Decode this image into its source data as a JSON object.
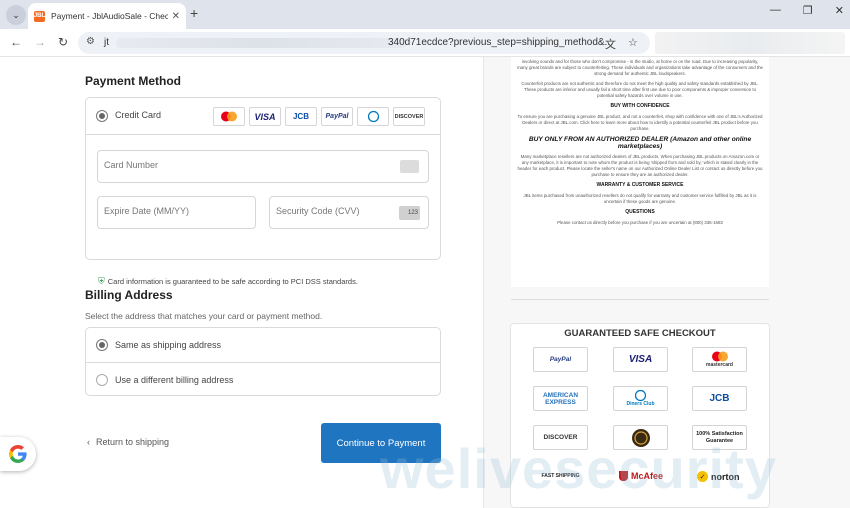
{
  "browser": {
    "tab_title": "Payment - JblAudioSale - Check",
    "tab_favicon": "JBL",
    "url_host": "jt",
    "url_path": "340d71ecdce?previous_step=shipping_method&..."
  },
  "payment": {
    "heading": "Payment Method",
    "credit_card_label": "Credit Card",
    "brands": [
      "mastercard",
      "VISA",
      "JCB",
      "PayPal",
      "Diners Club",
      "DISCOVER"
    ],
    "card_number_placeholder": "Card Number",
    "expiry_placeholder": "Expire Date (MM/YY)",
    "cvv_placeholder": "Security Code (CVV)",
    "cvv_icon_text": "123",
    "pci_note": "Card information is guaranteed to be safe according to PCI DSS standards."
  },
  "billing": {
    "heading": "Billing Address",
    "subtitle": "Select the address that matches your card or payment method.",
    "options": [
      "Same as shipping address",
      "Use a different billing address"
    ]
  },
  "actions": {
    "return_label": "Return to shipping",
    "continue_label": "Continue to Payment"
  },
  "doc": {
    "p1": "involving sounds and for those who don't compromise - in the studio, at home or on the road. Due to increasing popularity, many great brands are subject to counterfeiting. These individuals and organizations take advantage of the consumers and the strong demand for authentic JBL loudspeakers.",
    "p2": "Counterfeit products are not authentic and therefore do not meet the high quality and safety standards established by JBL. These products are inferior and usually fail a short time after first use due to poor components & improper conversion to potential safety hazards over volume in use.",
    "h1": "BUY WITH CONFIDENCE",
    "p3": "To ensure you are purchasing a genuine JBL product, and not a counterfeit, shop with confidence with one of JBL's Authorized Dealers or direct at JBL.com. Click here to learn more about how to identify a potential counterfeit JBL product before you purchase.",
    "h2": "BUY ONLY FROM AN AUTHORIZED DEALER (Amazon and other online marketplaces)",
    "p4": "Many marketplace resellers are not authorized dealers of JBL products. When purchasing JBL products on Amazon.com or any marketplace, it is important to note whom the product is being 'shipped from and sold by,' which is stated clearly in the header for each product. Please locate the seller's name on our Authorized Online Dealer List or contact us directly before you purchase to ensure they are an authorized dealer.",
    "h3": "WARRANTY & CUSTOMER SERVICE",
    "p5": "JBL items purchased from unauthorized resellers do not qualify for warranty and customer service fulfilled by JBL as it is uncertain if these goods are genuine.",
    "h4": "QUESTIONS",
    "p6": "Please contact us directly before you purchase if you are uncertain at (800) 336-1683"
  },
  "safe_checkout": {
    "title": "GUARANTEED SAFE CHECKOUT",
    "badges": [
      "PayPal",
      "VISA",
      "mastercard",
      "AMERICAN EXPRESS",
      "Diners Club",
      "JCB",
      "DISCOVER",
      "",
      "100% Satisfaction Guarantee",
      "FAST SHIPPING",
      "McAfee",
      "norton"
    ]
  },
  "watermark": "welivesecurity",
  "colors": {
    "primary_button": "#1f75bf",
    "shield": "#3a9a57"
  }
}
